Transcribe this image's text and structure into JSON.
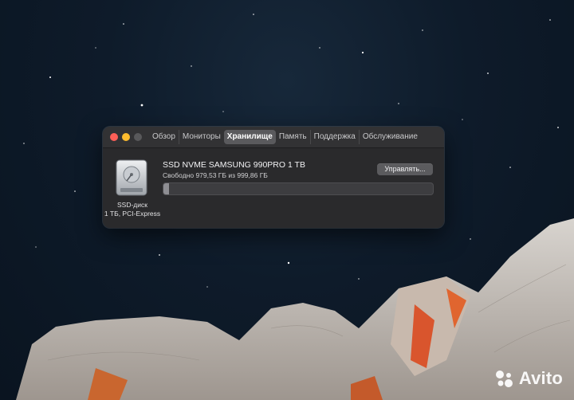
{
  "window": {
    "tabs": [
      {
        "label": "Обзор"
      },
      {
        "label": "Мониторы"
      },
      {
        "label": "Хранилище"
      },
      {
        "label": "Память"
      },
      {
        "label": "Поддержка"
      },
      {
        "label": "Обслуживание"
      }
    ],
    "active_tab": "Хранилище"
  },
  "storage": {
    "drive_type": "SSD-диск",
    "drive_spec": "1 ТБ, PCI-Express",
    "drive_name": "SSD NVME SAMSUNG 990PRO 1 TB",
    "free_text": "Свободно 979,53 ГБ из 999,86 ГБ",
    "used_fraction": 0.0203,
    "manage_label": "Управлять..."
  },
  "watermark": {
    "text": "Avito"
  },
  "colors": {
    "close": "#fe5f57",
    "minimize": "#febc2e",
    "maximize_inactive": "#59595b",
    "active_tab": "#5a5a5d"
  }
}
